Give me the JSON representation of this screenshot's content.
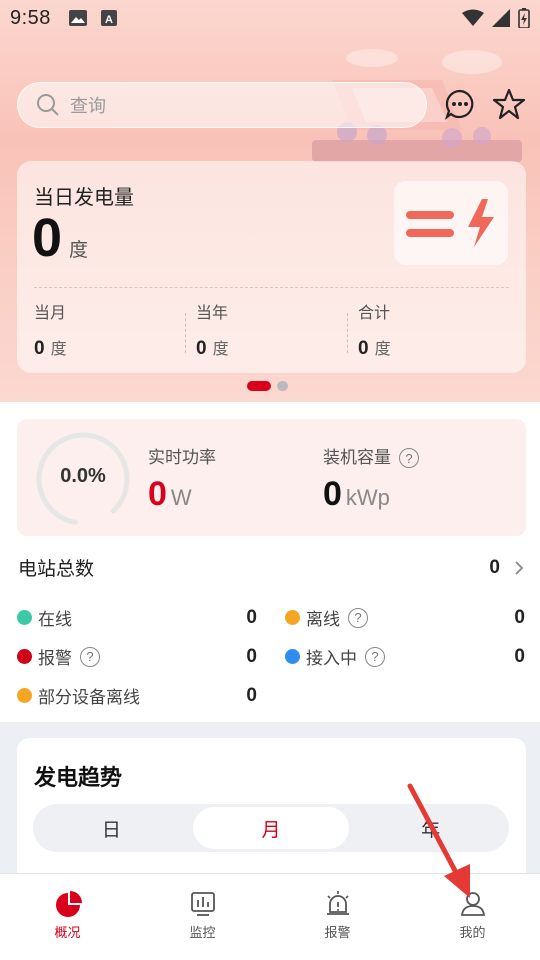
{
  "status_bar": {
    "time": "9:58"
  },
  "search": {
    "placeholder": "查询"
  },
  "generation": {
    "title": "当日发电量",
    "value": "0",
    "unit": "度",
    "stats": [
      {
        "label": "当月",
        "value": "0",
        "unit": "度"
      },
      {
        "label": "当年",
        "value": "0",
        "unit": "度"
      },
      {
        "label": "合计",
        "value": "0",
        "unit": "度"
      }
    ]
  },
  "power": {
    "ratio": "0.0%",
    "realtime_label": "实时功率",
    "realtime_value": "0",
    "realtime_unit": "W",
    "capacity_label": "装机容量",
    "capacity_value": "0",
    "capacity_unit": "kWp"
  },
  "stations": {
    "title": "电站总数",
    "total": "0",
    "items": [
      {
        "label": "在线",
        "value": "0",
        "color": "#3cc9a8"
      },
      {
        "label": "离线",
        "value": "0",
        "color": "#f5a623"
      },
      {
        "label": "报警",
        "value": "0",
        "color": "#d0021b"
      },
      {
        "label": "接入中",
        "value": "0",
        "color": "#2f8cf0"
      },
      {
        "label": "部分设备离线",
        "value": "0",
        "color": "#f5a623"
      }
    ]
  },
  "trend": {
    "title": "发电趋势",
    "tabs": [
      "日",
      "月",
      "年"
    ],
    "active_tab": "月"
  },
  "tabbar": {
    "items": [
      {
        "label": "概况",
        "icon": "overview-pie-icon"
      },
      {
        "label": "监控",
        "icon": "monitor-icon"
      },
      {
        "label": "报警",
        "icon": "alarm-icon"
      },
      {
        "label": "我的",
        "icon": "user-icon"
      }
    ],
    "active": "概况"
  },
  "accent_color": "#d9001b"
}
